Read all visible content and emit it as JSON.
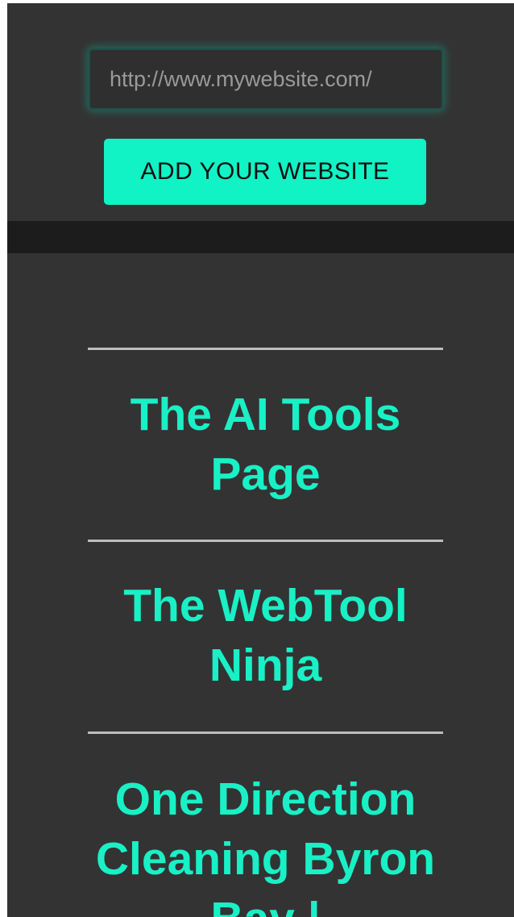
{
  "search": {
    "placeholder": "http://www.mywebsite.com/",
    "value": ""
  },
  "submit_label": "ADD YOUR WEBSITE",
  "sites": [
    {
      "title": "The AI Tools Page"
    },
    {
      "title": "The WebTool Ninja"
    },
    {
      "title": "One Direction Cleaning Byron Bay |"
    }
  ],
  "colors": {
    "accent": "#11f2c5",
    "background": "#333333",
    "band": "#1c1c1c",
    "divider": "#bdbdbd"
  }
}
